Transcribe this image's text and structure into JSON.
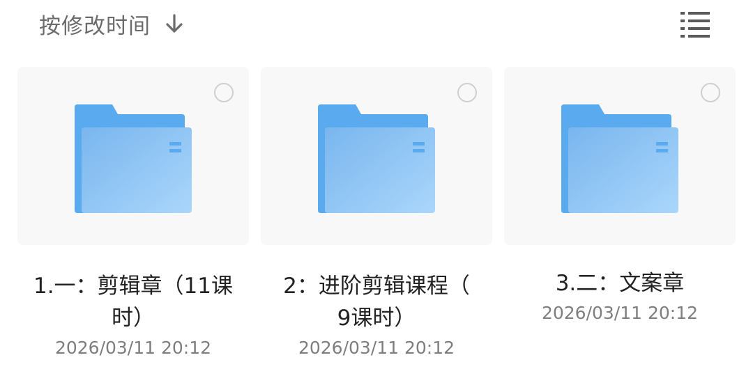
{
  "toolbar": {
    "sort_label": "按修改时间",
    "sort_icon": "arrow-down-icon",
    "view_icon": "list-view-icon"
  },
  "folders": [
    {
      "name_line1": "1.一：剪辑章（11课",
      "name_line2": "时）",
      "date": "2026/03/11 20:12"
    },
    {
      "name_line1": "2：进阶剪辑课程（",
      "name_line2": "9课时）",
      "date": "2026/03/11 20:12"
    },
    {
      "name_line1": "3.二：文案章",
      "name_line2": "",
      "date": "2026/03/11 20:12"
    }
  ],
  "colors": {
    "folder_back": "#5aaaf0",
    "folder_front_start": "#79b6ee",
    "folder_front_end": "#aad6fb",
    "tile_bg": "#f8f8f8",
    "text_secondary": "#7e7e7e"
  }
}
